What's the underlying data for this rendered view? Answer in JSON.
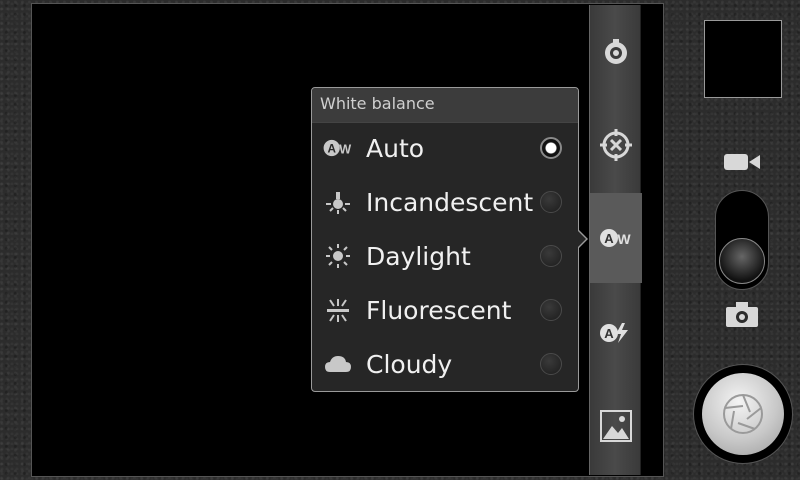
{
  "popup": {
    "title": "White balance",
    "options": [
      {
        "label": "Auto",
        "icon": "auto-wb-icon",
        "selected": true
      },
      {
        "label": "Incandescent",
        "icon": "incandescent-icon",
        "selected": false
      },
      {
        "label": "Daylight",
        "icon": "daylight-icon",
        "selected": false
      },
      {
        "label": "Fluorescent",
        "icon": "fluorescent-icon",
        "selected": false
      },
      {
        "label": "Cloudy",
        "icon": "cloudy-icon",
        "selected": false
      }
    ]
  },
  "sidebar": {
    "buttons": [
      {
        "icon": "settings-dial-icon"
      },
      {
        "icon": "focus-target-icon"
      },
      {
        "icon": "auto-wb-icon",
        "active": true
      },
      {
        "icon": "auto-flash-icon"
      },
      {
        "icon": "gallery-icon"
      }
    ]
  },
  "controls": {
    "mode_selected": "camera"
  },
  "colors": {
    "background": "#2c2c2c",
    "popup_bg": "#262626",
    "header_bg": "#3c3c3c",
    "text": "#f0f0f0"
  }
}
